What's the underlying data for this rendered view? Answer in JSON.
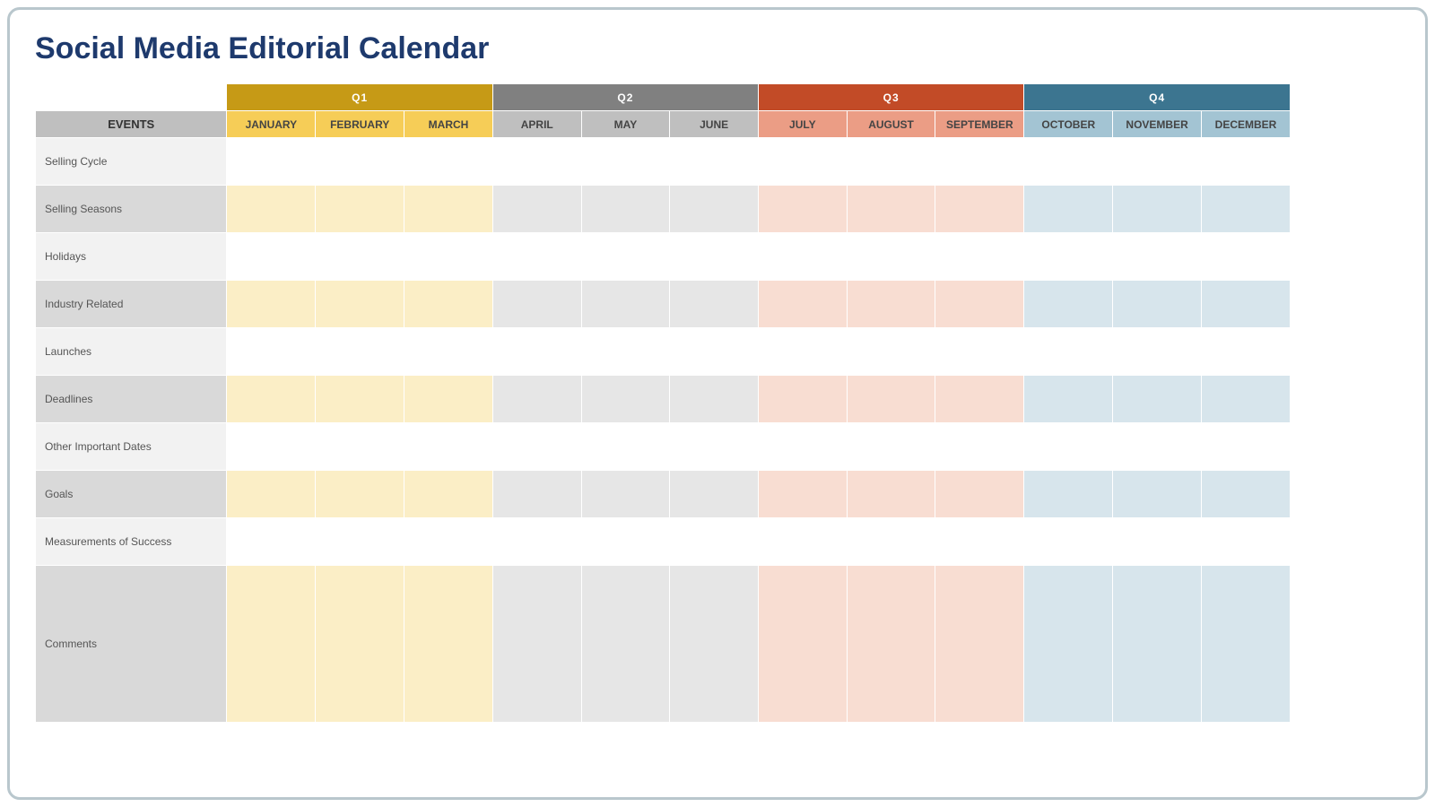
{
  "title": "Social Media Editorial Calendar",
  "events_header": "EVENTS",
  "quarters": [
    {
      "label": "Q1",
      "months": [
        "JANUARY",
        "FEBRUARY",
        "MARCH"
      ]
    },
    {
      "label": "Q2",
      "months": [
        "APRIL",
        "MAY",
        "JUNE"
      ]
    },
    {
      "label": "Q3",
      "months": [
        "JULY",
        "AUGUST",
        "SEPTEMBER"
      ]
    },
    {
      "label": "Q4",
      "months": [
        "OCTOBER",
        "NOVEMBER",
        "DECEMBER"
      ]
    }
  ],
  "rows": [
    {
      "label": "Selling Cycle",
      "tall": false
    },
    {
      "label": "Selling Seasons",
      "tall": false
    },
    {
      "label": "Holidays",
      "tall": false
    },
    {
      "label": "Industry Related",
      "tall": false
    },
    {
      "label": "Launches",
      "tall": false
    },
    {
      "label": "Deadlines",
      "tall": false
    },
    {
      "label": "Other Important Dates",
      "tall": false
    },
    {
      "label": "Goals",
      "tall": false
    },
    {
      "label": "Measurements of Success",
      "tall": false
    },
    {
      "label": "Comments",
      "tall": true
    }
  ],
  "colors": {
    "title": "#1e3a6d",
    "q1": "#c69a16",
    "q2": "#808080",
    "q3": "#c24b27",
    "q4": "#3c7590",
    "m1": "#f6cd57",
    "m2": "#bfbfbf",
    "m3": "#eb9d85",
    "m4": "#a3c4d3",
    "q1_light": "#fbeec6",
    "q2_light": "#e6e6e6",
    "q3_light": "#f8ddd2",
    "q4_light": "#d7e5ec",
    "label_odd": "#f2f2f2",
    "label_even": "#d9d9d9"
  }
}
